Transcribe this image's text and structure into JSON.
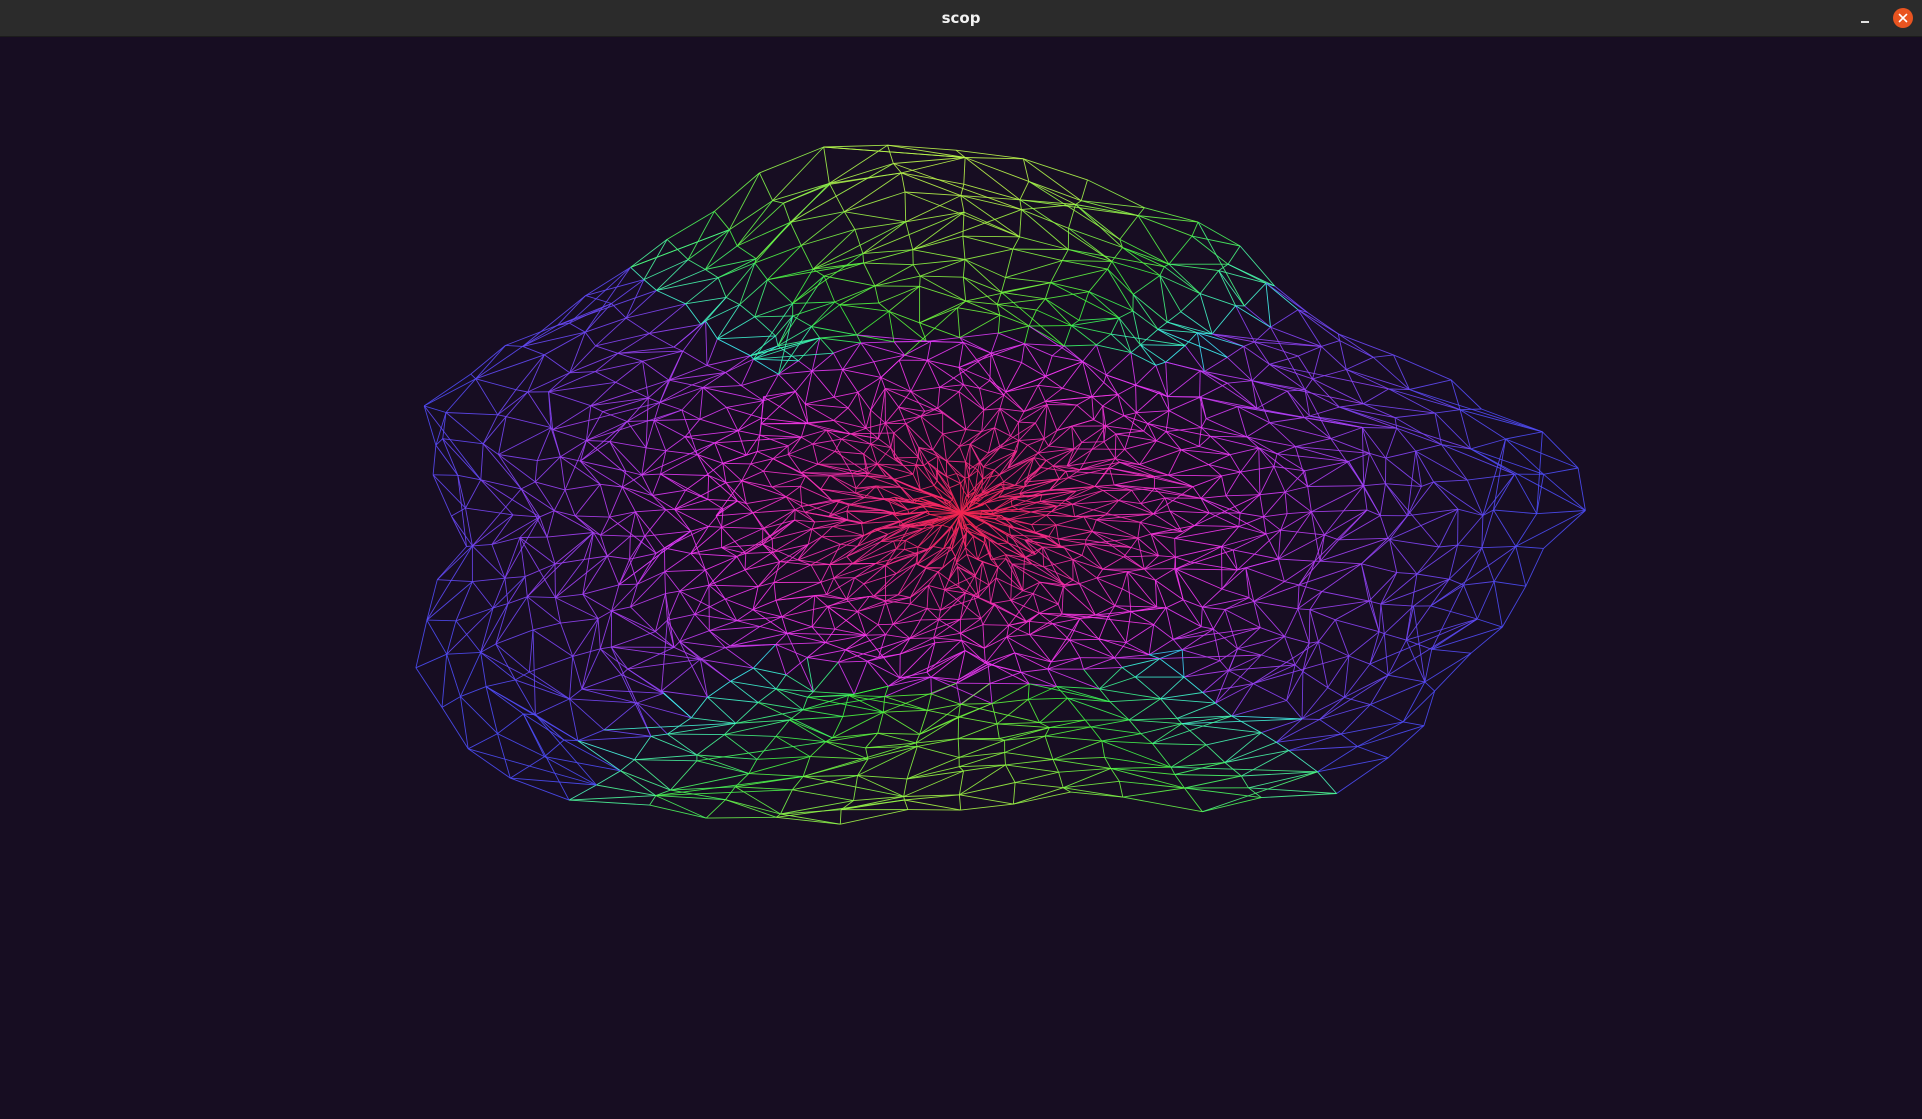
{
  "window": {
    "title": "scop",
    "buttons": {
      "minimize_icon": "minimize-icon",
      "close_icon": "close-icon"
    }
  },
  "viewport": {
    "background": "#170d22",
    "render_mode": "wireframe"
  },
  "colors": {
    "titlebar": "#2b2b2b",
    "close_button": "#e95420"
  }
}
